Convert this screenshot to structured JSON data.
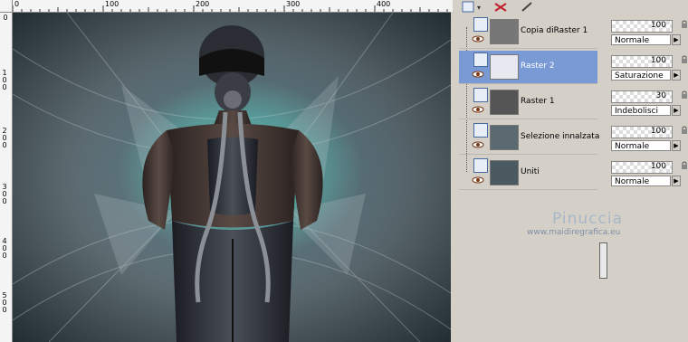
{
  "rulers": {
    "top_labels": [
      "0",
      "100",
      "200",
      "300",
      "400"
    ],
    "left_labels": [
      "0",
      "100",
      "200",
      "300",
      "400",
      "500"
    ]
  },
  "layers": [
    {
      "name": "Copia diRaster 1",
      "selected": false,
      "visible": true
    },
    {
      "name": "Raster 2",
      "selected": true,
      "visible": true
    },
    {
      "name": "Raster 1",
      "selected": false,
      "visible": true
    },
    {
      "name": "Selezione innalzata",
      "selected": false,
      "visible": true
    },
    {
      "name": "Uniti",
      "selected": false,
      "visible": true
    }
  ],
  "properties": [
    {
      "opacity": "100",
      "blend": "Normale"
    },
    {
      "opacity": "100",
      "blend": "Saturazione"
    },
    {
      "opacity": "30",
      "blend": "Indebolisci"
    },
    {
      "opacity": "100",
      "blend": "Normale"
    },
    {
      "opacity": "100",
      "blend": "Normale"
    }
  ],
  "watermark": {
    "name": "Pinuccia",
    "url": "www.maidiregrafica.eu"
  },
  "colors": {
    "selection": "#7a9ad6",
    "panel_bg": "#d4d0c8"
  }
}
